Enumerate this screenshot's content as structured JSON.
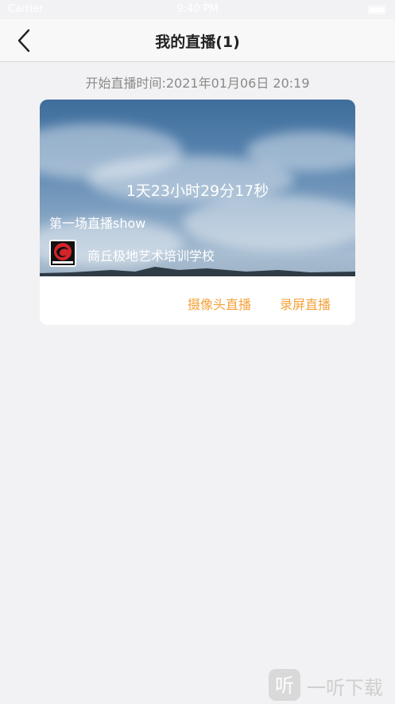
{
  "status_bar": {
    "carrier": "Carrier",
    "time": "9:40 PM"
  },
  "nav": {
    "title": "我的直播(1)"
  },
  "live": {
    "start_time": "开始直播时间:2021年01月06日 20:19",
    "countdown": "1天23小时29分17秒",
    "title": "第一场直播show",
    "school_name": "商丘极地艺术培训学校",
    "logo_caption": "JIDIYISHU",
    "actions": {
      "camera": "摄像头直播",
      "screen": "录屏直播"
    }
  },
  "watermark": {
    "icon_text": "听",
    "text": "一听下载"
  },
  "colors": {
    "accent": "#f5a23a",
    "background": "#f2f2f4"
  }
}
